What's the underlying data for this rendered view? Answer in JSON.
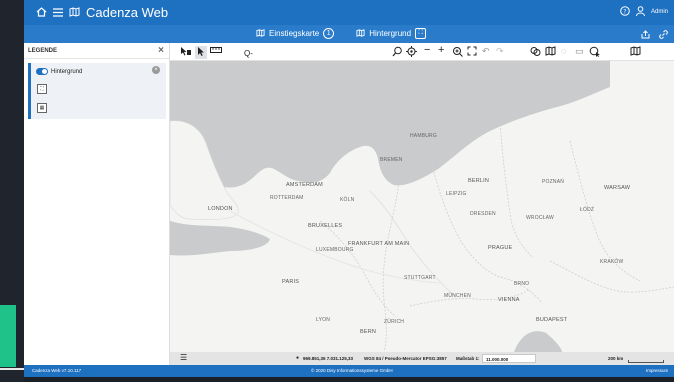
{
  "app": {
    "title": "Cadenza Web",
    "user": "Admin"
  },
  "tabs": [
    {
      "label": "Einstiegskarte",
      "badge": "1"
    },
    {
      "label": "Hintergrund"
    }
  ],
  "legend": {
    "title": "LEGENDE",
    "layer": {
      "label": "Hintergrund"
    }
  },
  "toolbar": {
    "search_label": "Q-"
  },
  "status": {
    "coordinates": "969.851,35  7.031.125,33",
    "crs": "WGS 84 / Pseudo-Mercator EPSG:3857",
    "scale_label": "Maßstab 1:",
    "scale_value": "11.000.000",
    "scalebar": "200 km"
  },
  "footer": {
    "version": "Cadenza Web v7.10.117",
    "copyright": "© 2020 Disy Informationssysteme GmbH",
    "imprint": "Impressum"
  },
  "map_labels": [
    {
      "text": "LONDON",
      "cls": "big"
    },
    {
      "text": "AMSTERDAM",
      "cls": "big"
    },
    {
      "text": "BRUXELLES",
      "cls": "big"
    },
    {
      "text": "BERLIN",
      "cls": "big"
    },
    {
      "text": "WARSAW",
      "cls": "big"
    },
    {
      "text": "PRAGUE",
      "cls": "big"
    },
    {
      "text": "FRANKFURT AM MAIN",
      "cls": "big"
    },
    {
      "text": "PARIS",
      "cls": "big"
    },
    {
      "text": "VIENNA",
      "cls": "big"
    },
    {
      "text": "BUDAPEST",
      "cls": "big"
    },
    {
      "text": "BERN",
      "cls": "big"
    },
    {
      "text": "MÜNCHEN",
      "cls": ""
    },
    {
      "text": "HAMBURG",
      "cls": ""
    },
    {
      "text": "KÖLN",
      "cls": ""
    },
    {
      "text": "LYON",
      "cls": ""
    },
    {
      "text": "KRAKÓW",
      "cls": ""
    },
    {
      "text": "LEIPZIG",
      "cls": ""
    },
    {
      "text": "DRESDEN",
      "cls": ""
    },
    {
      "text": "STUTTGART",
      "cls": ""
    },
    {
      "text": "ZÜRICH",
      "cls": ""
    },
    {
      "text": "BRNO",
      "cls": ""
    },
    {
      "text": "LUXEMBOURG",
      "cls": ""
    },
    {
      "text": "ROTTERDAM",
      "cls": ""
    },
    {
      "text": "BREMEN",
      "cls": ""
    },
    {
      "text": "POZNAŃ",
      "cls": ""
    },
    {
      "text": "WROCŁAW",
      "cls": ""
    },
    {
      "text": "ŁÓDŹ",
      "cls": ""
    }
  ]
}
